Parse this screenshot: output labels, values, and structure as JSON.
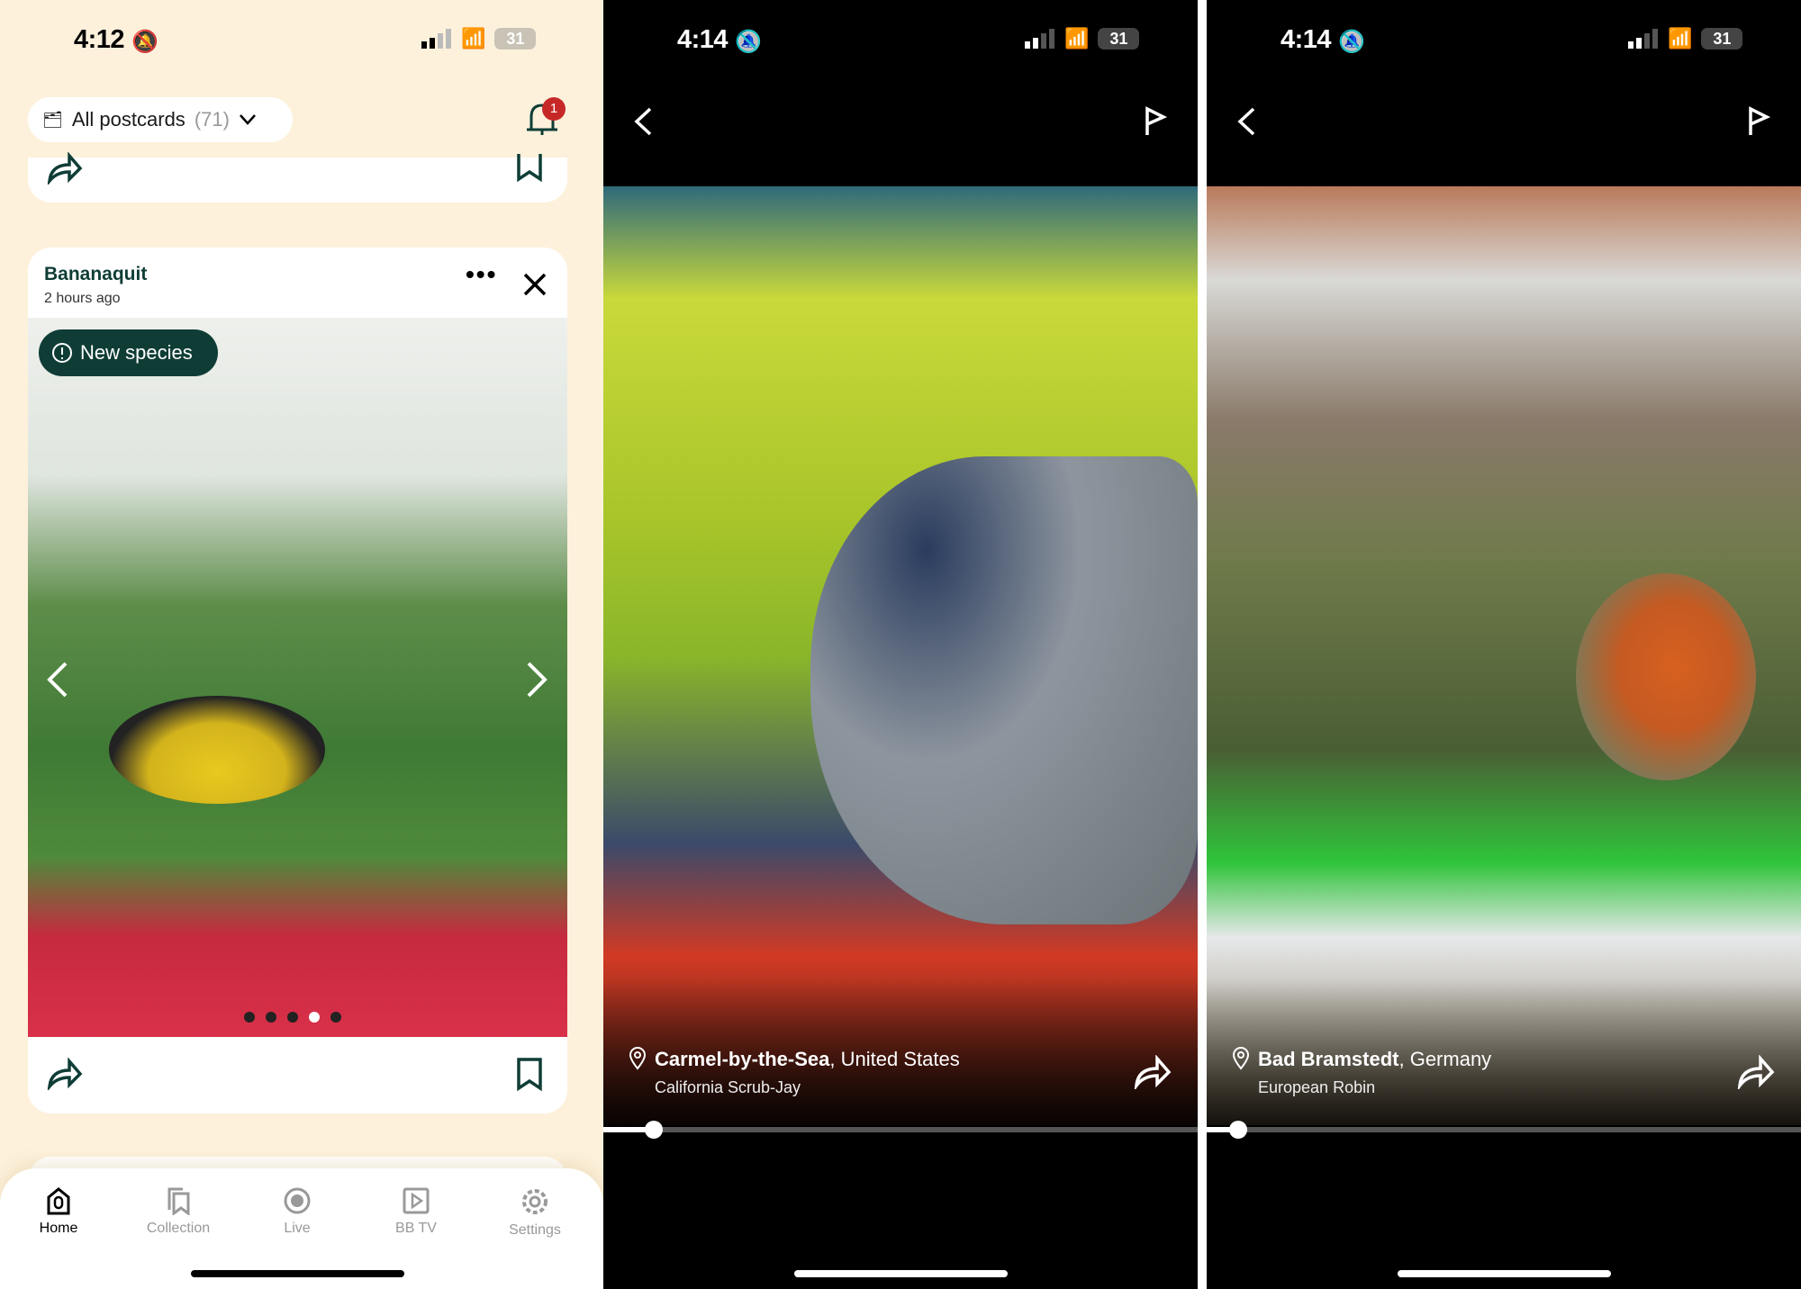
{
  "panel1": {
    "status": {
      "time": "4:12",
      "battery": "31"
    },
    "filter": {
      "label": "All postcards",
      "count": "(71)"
    },
    "notifications": {
      "badge": "1"
    },
    "card": {
      "title": "Bananaquit",
      "time": "2 hours ago",
      "badge": "New species",
      "pages": 5,
      "current_page": 4
    },
    "nav": [
      {
        "label": "Home",
        "active": true
      },
      {
        "label": "Collection"
      },
      {
        "label": "Live"
      },
      {
        "label": "BB TV"
      },
      {
        "label": "Settings"
      }
    ]
  },
  "panel2": {
    "status": {
      "time": "4:14",
      "battery": "31"
    },
    "city": "Carmel-by-the-Sea",
    "country": ", United States",
    "species": "California Scrub-Jay",
    "progress": 0.08
  },
  "panel3": {
    "status": {
      "time": "4:14",
      "battery": "31"
    },
    "city": "Bad Bramstedt",
    "country": ", Germany",
    "species": "European Robin",
    "progress": 0.05
  },
  "colors": {
    "accent": "#0f3d36",
    "background": "#fdf1dc",
    "badge_red": "#c62828"
  }
}
